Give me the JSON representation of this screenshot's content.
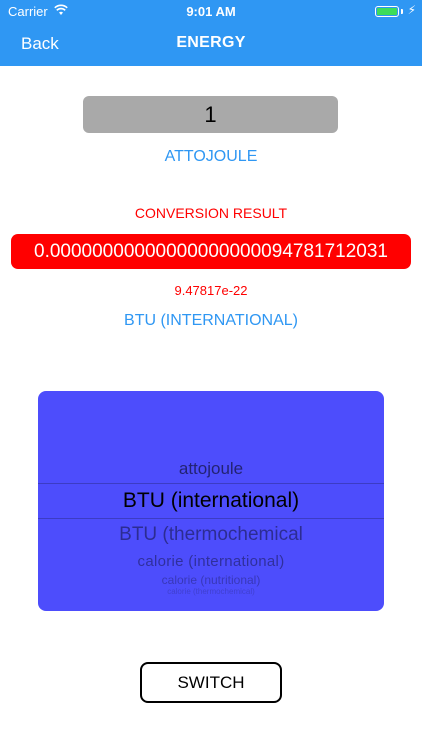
{
  "status_bar": {
    "carrier": "Carrier",
    "time": "9:01 AM",
    "wifi_icon": "wifi-icon",
    "battery_icon": "battery-icon",
    "charging_icon": "charging-bolt-icon"
  },
  "nav": {
    "back_label": "Back",
    "title": "ENERGY"
  },
  "converter": {
    "input_value": "1",
    "from_unit": "ATTOJOULE",
    "result_heading": "CONVERSION RESULT",
    "result_value": "0.00000000000000000000094781712031",
    "result_scientific": "9.47817e-22",
    "to_unit": "BTU (INTERNATIONAL)"
  },
  "picker": {
    "previous": "attojoule",
    "selected": "BTU (international)",
    "next": [
      "BTU (thermochemical",
      "calorie (international)",
      "calorie (nutritional)",
      "calorie (thermochemical)"
    ]
  },
  "switch_label": "SWITCH",
  "colors": {
    "accent": "#2f97f3",
    "result": "#ff0000",
    "picker_bg": "#4d4dfc",
    "input_bg": "#a9a9a9"
  }
}
